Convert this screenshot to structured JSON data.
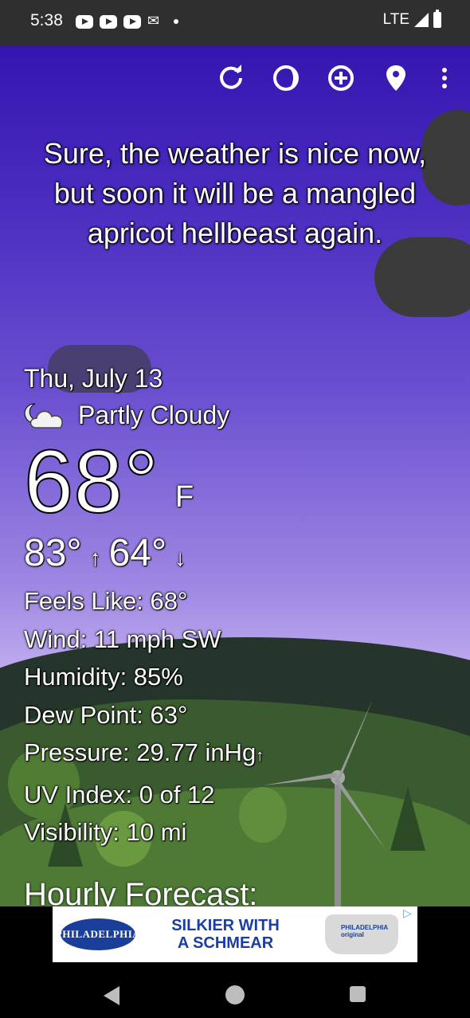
{
  "status_bar": {
    "time": "5:38",
    "network": "LTE",
    "icons": [
      "youtube-icon",
      "youtube-icon",
      "youtube-icon",
      "gmail-icon",
      "dot-icon"
    ]
  },
  "toolbar": {
    "icons": [
      "refresh-icon",
      "theme-icon",
      "add-location-icon",
      "location-pin-icon",
      "more-vert-icon"
    ]
  },
  "quote": "Sure, the weather is nice now, but soon it will be a mangled apricot hellbeast again.",
  "weather": {
    "date": "Thu, July 13",
    "condition": "Partly Cloudy",
    "condition_icon": "partly-cloudy-night-icon",
    "temperature": "68°",
    "unit": "F",
    "high": "83°",
    "low": "64°",
    "feels_like": "Feels Like:  68°",
    "wind": "Wind:  11 mph SW",
    "humidity": "Humidity:  85%",
    "dew_point": "Dew Point:  63°",
    "pressure": "Pressure:  29.77 inHg",
    "pressure_trend": "↑",
    "uv_index": "UV Index:  0 of 12",
    "visibility": "Visibility:  10 mi"
  },
  "hourly_title": "Hourly Forecast:",
  "ad": {
    "brand": "PHILADELPHIA",
    "headline": "SILKIER WITH A SCHMEAR",
    "product_label": "PHILADELPHIA original"
  },
  "navigation": [
    "back",
    "home",
    "recents"
  ]
}
